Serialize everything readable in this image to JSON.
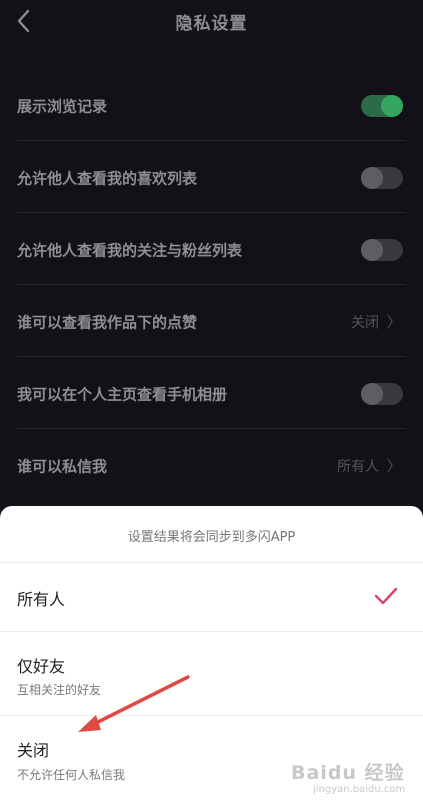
{
  "header": {
    "title": "隐私设置"
  },
  "settings": [
    {
      "label": "展示浏览记录",
      "control": "toggle",
      "state": "on"
    },
    {
      "label": "允许他人查看我的喜欢列表",
      "control": "toggle",
      "state": "off"
    },
    {
      "label": "允许他人查看我的关注与粉丝列表",
      "control": "toggle",
      "state": "off"
    },
    {
      "label": "谁可以查看我作品下的点赞",
      "control": "value",
      "value": "关闭"
    },
    {
      "label": "我可以在个人主页查看手机相册",
      "control": "toggle",
      "state": "off"
    },
    {
      "label": "谁可以私信我",
      "control": "value",
      "value": "所有人"
    }
  ],
  "sheet": {
    "note": "设置结果将会同步到多闪APP",
    "options": [
      {
        "label": "所有人",
        "sub": "",
        "selected": true
      },
      {
        "label": "仅好友",
        "sub": "互相关注的好友",
        "selected": false
      },
      {
        "label": "关闭",
        "sub": "不允许任何人私信我",
        "selected": false
      }
    ]
  },
  "colors": {
    "check": "#d6476a",
    "annotation_arrow": "#e04a40",
    "toggle_on": "#35a562"
  },
  "watermark": {
    "brand": "Baidu 经验",
    "sub": "jingyan.baidu.com"
  }
}
